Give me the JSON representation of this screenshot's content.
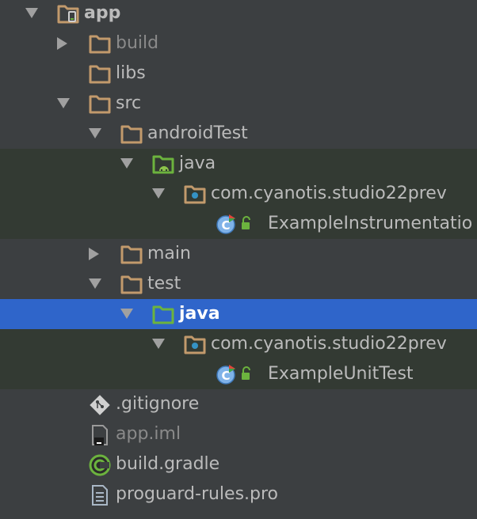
{
  "colors": {
    "background": "#3c3f41",
    "selection": "#2f65ca",
    "test_tint": "#333a33",
    "folder": "#c29a6c",
    "java_folder_green": "#6cb33e",
    "package_dot": "#3592c4"
  },
  "tree": {
    "rows": [
      {
        "label": "app",
        "arrow": "down",
        "icon": "module-folder-icon"
      },
      {
        "label": "build",
        "arrow": "right",
        "icon": "folder-icon",
        "excluded": true
      },
      {
        "label": "libs",
        "arrow": "none",
        "icon": "folder-icon"
      },
      {
        "label": "src",
        "arrow": "down",
        "icon": "folder-icon"
      },
      {
        "label": "androidTest",
        "arrow": "down",
        "icon": "folder-icon"
      },
      {
        "label": "java",
        "arrow": "down",
        "icon": "android-test-folder-icon"
      },
      {
        "label": "com.cyanotis.studio22prev",
        "arrow": "down",
        "icon": "package-icon"
      },
      {
        "label": "ExampleInstrumentatio",
        "arrow": "none",
        "icon": "test-class-icon"
      },
      {
        "label": "main",
        "arrow": "right",
        "icon": "folder-icon"
      },
      {
        "label": "test",
        "arrow": "down",
        "icon": "folder-icon"
      },
      {
        "label": "java",
        "arrow": "down",
        "icon": "test-folder-icon",
        "selected": true
      },
      {
        "label": "com.cyanotis.studio22prev",
        "arrow": "down",
        "icon": "package-icon"
      },
      {
        "label": "ExampleUnitTest",
        "arrow": "none",
        "icon": "test-class-icon"
      },
      {
        "label": ".gitignore",
        "arrow": "none",
        "icon": "git-file-icon"
      },
      {
        "label": "app.iml",
        "arrow": "none",
        "icon": "iml-file-icon",
        "excluded": true
      },
      {
        "label": "build.gradle",
        "arrow": "none",
        "icon": "gradle-icon"
      },
      {
        "label": "proguard-rules.pro",
        "arrow": "none",
        "icon": "text-file-icon"
      }
    ]
  }
}
